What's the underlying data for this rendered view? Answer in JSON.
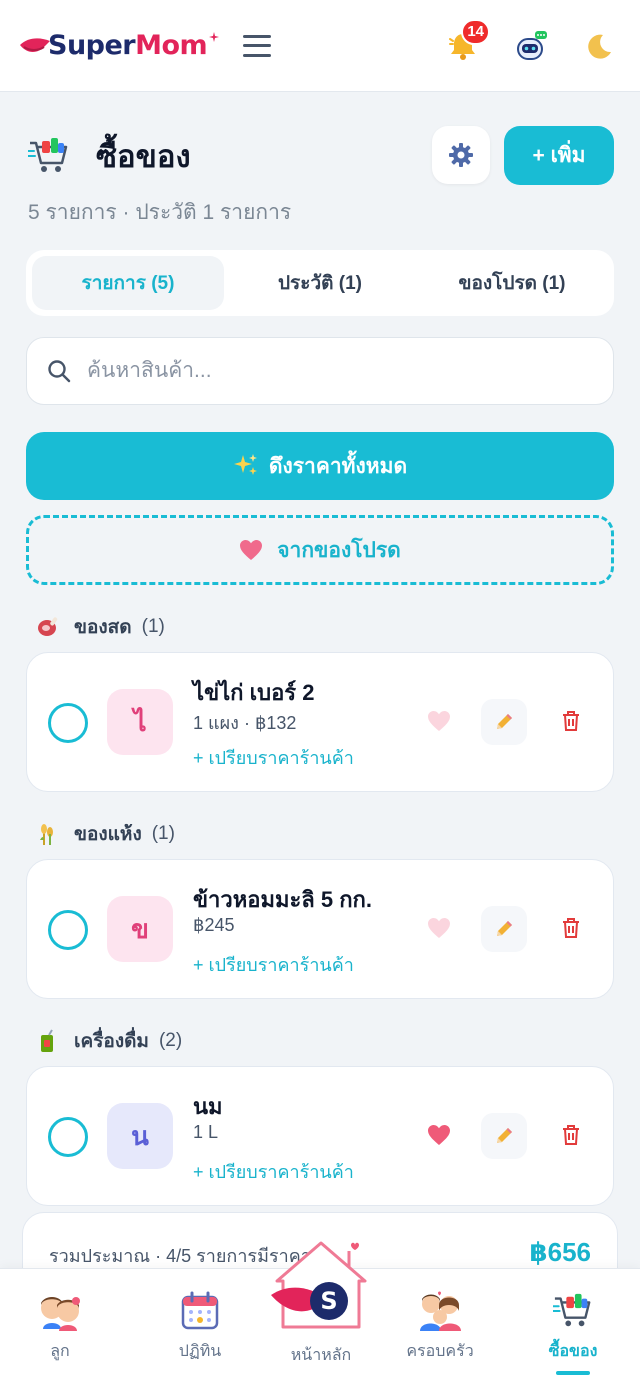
{
  "header": {
    "logo_super": "Super",
    "logo_mom": "Mom",
    "notification_count": "14"
  },
  "page": {
    "title": "ซื้อของ",
    "add_label": "+ เพิ่ม",
    "subtitle": "5 รายการ · ประวัติ 1 รายการ"
  },
  "tabs": [
    {
      "label": "รายการ (5)",
      "active": true
    },
    {
      "label": "ประวัติ (1)",
      "active": false
    },
    {
      "label": "ของโปรด (1)",
      "active": false
    }
  ],
  "search": {
    "placeholder": "ค้นหาสินค้า..."
  },
  "actions": {
    "fetch_prices": "ดึงราคาทั้งหมด",
    "from_favorites": "จากของโปรด"
  },
  "categories": [
    {
      "name": "ของสด",
      "count": "(1)",
      "items": [
        {
          "initial": "ไ",
          "name": "ไข่ไก่ เบอร์ 2",
          "meta": "1 แผง · ฿132",
          "compare": "+ เปรียบราคาร้านค้า",
          "favorite": false
        }
      ]
    },
    {
      "name": "ของแห้ง",
      "count": "(1)",
      "items": [
        {
          "initial": "ข",
          "name": "ข้าวหอมมะลิ 5 กก.",
          "meta": "฿245",
          "compare": "+ เปรียบราคาร้านค้า",
          "favorite": false
        }
      ]
    },
    {
      "name": "เครื่องดื่ม",
      "count": "(2)",
      "items": [
        {
          "initial": "น",
          "name": "นม",
          "meta": "1 L",
          "compare": "+ เปรียบราคาร้านค้า",
          "favorite": true
        }
      ]
    }
  ],
  "summary": {
    "label": "รวมประมาณ · 4/5 รายการมีราคา",
    "total": "฿656"
  },
  "bottom_nav": [
    {
      "label": "ลูก",
      "icon": "kids-icon"
    },
    {
      "label": "ปฏิทิน",
      "icon": "calendar-icon"
    },
    {
      "label": "หน้าหลัก",
      "icon": "home-icon"
    },
    {
      "label": "ครอบครัว",
      "icon": "family-icon"
    },
    {
      "label": "ซื้อของ",
      "icon": "shopping-cart-icon",
      "active": true
    }
  ],
  "colors": {
    "accent": "#19bcd4",
    "brand": "#e2245a",
    "danger": "#ef2b2b"
  }
}
